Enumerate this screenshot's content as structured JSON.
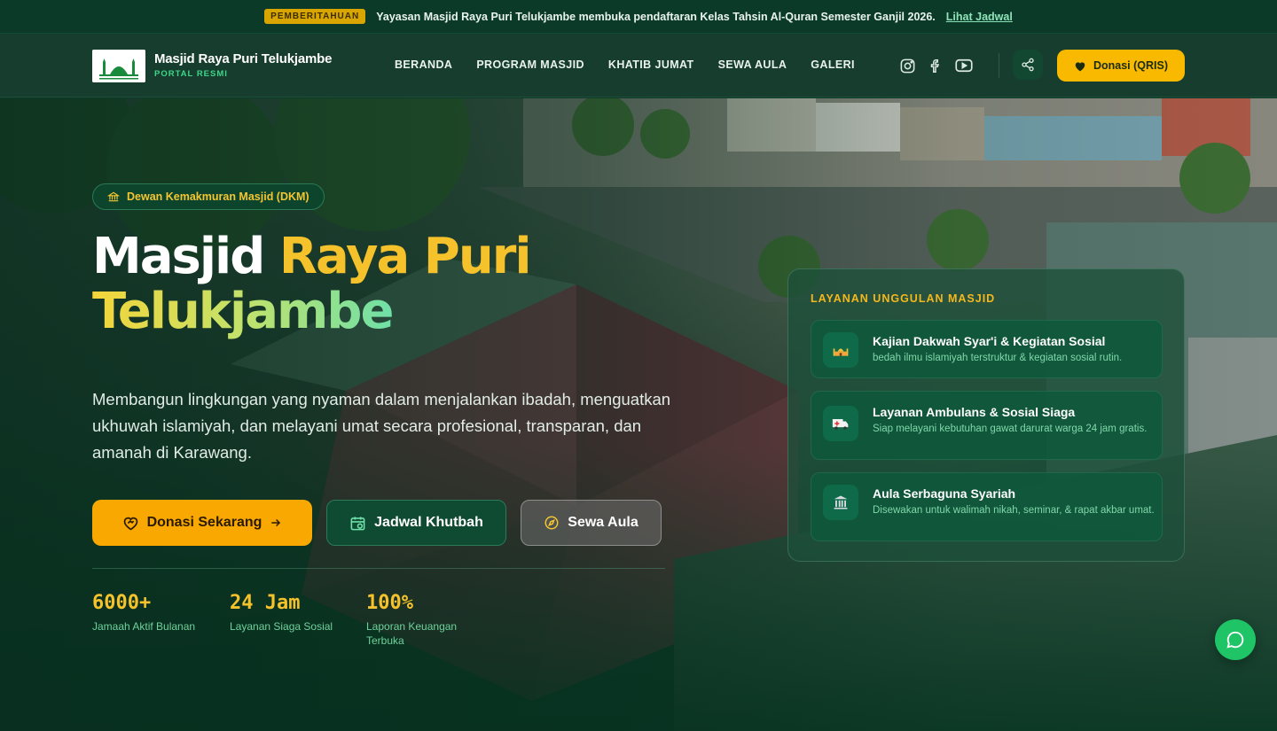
{
  "announcement": {
    "tag": "PEMBERITAHUAN",
    "message": "Yayasan Masjid Raya Puri Telukjambe membuka pendaftaran Kelas Tahsin Al-Quran Semester Ganjil 2026.",
    "link": "Lihat Jadwal"
  },
  "header": {
    "brand_title": "Masjid Raya Puri Telukjambe",
    "brand_subtitle": "PORTAL RESMI",
    "nav": [
      "BERANDA",
      "PROGRAM MASJID",
      "KHATIB JUMAT",
      "SEWA AULA",
      "GALERI"
    ],
    "social_icons": [
      "instagram-icon",
      "facebook-icon",
      "youtube-icon"
    ],
    "donate_label": "Donasi (QRIS)"
  },
  "hero": {
    "badge": "Dewan Kemakmuran Masjid (DKM)",
    "title_white": "Masjid",
    "title_yellow": "Raya Puri",
    "title_gradient": "Telukjambe",
    "lead": "Membangun lingkungan yang nyaman dalam menjalankan ibadah, menguatkan ukhuwah islamiyah, dan melayani umat secara profesional, transparan, dan amanah di Karawang.",
    "buttons": {
      "donate": "Donasi Sekarang",
      "schedule": "Jadwal Khutbah",
      "hall": "Sewa Aula"
    },
    "stats": [
      {
        "value": "6000+",
        "label": "Jamaah Aktif Bulanan"
      },
      {
        "value": "24 Jam",
        "label": "Layanan Siaga Sosial"
      },
      {
        "value": "100%",
        "label": "Laporan Keuangan Terbuka"
      }
    ]
  },
  "services": {
    "title": "LAYANAN UNGGULAN MASJID",
    "items": [
      {
        "title": "Kajian Dakwah Syar'i & Kegiatan Sosial",
        "desc": "bedah ilmu islamiyah terstruktur & kegiatan sosial rutin.",
        "icon": "mosque-icon"
      },
      {
        "title": "Layanan Ambulans & Sosial Siaga",
        "desc": "Siap melayani kebutuhan gawat darurat warga 24 jam gratis.",
        "icon": "ambulance-icon"
      },
      {
        "title": "Aula Serbaguna Syariah",
        "desc": "Disewakan untuk walimah nikah, seminar, & rapat akbar umat.",
        "icon": "building-icon"
      }
    ]
  },
  "colors": {
    "accent": "#f8b900",
    "primary_green": "#0f4a33",
    "chat_green": "#1fc467"
  }
}
